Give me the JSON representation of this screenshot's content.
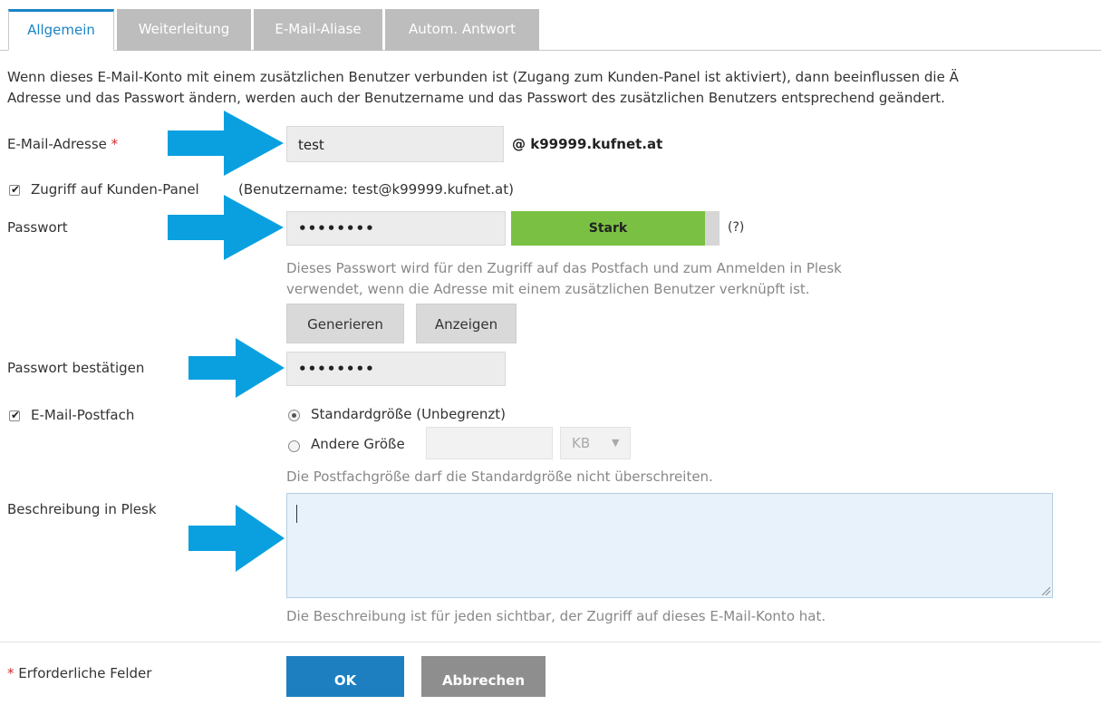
{
  "tabs": [
    {
      "label": "Allgemein"
    },
    {
      "label": "Weiterleitung"
    },
    {
      "label": "E-Mail-Aliase"
    },
    {
      "label": "Autom. Antwort"
    }
  ],
  "info_line1": "Wenn dieses E-Mail-Konto mit einem zusätzlichen Benutzer verbunden ist (Zugang zum Kunden-Panel ist aktiviert), dann beeinflussen die Ä",
  "info_line2": "Adresse und das Passwort ändern, werden auch der Benutzername und das Passwort des zusätzlichen Benutzers entsprechend geändert.",
  "email": {
    "label": "E-Mail-Adresse",
    "required_mark": "*",
    "value": "test",
    "domain": "@ k99999.kufnet.at"
  },
  "panel_access": {
    "checked": true,
    "label": "Zugriff auf Kunden-Panel",
    "username_note": "(Benutzername: test@k99999.kufnet.at)"
  },
  "password": {
    "label": "Passwort",
    "value": "••••••••",
    "strength": "Stark",
    "strength_color": "#7ac143",
    "help": "(?)",
    "hint_line1": "Dieses Passwort wird für den Zugriff auf das Postfach und zum Anmelden in Plesk",
    "hint_line2": "verwendet, wenn die Adresse mit einem zusätzlichen Benutzer verknüpft ist.",
    "generate_label": "Generieren",
    "show_label": "Anzeigen"
  },
  "confirm": {
    "label": "Passwort bestätigen",
    "value": "••••••••"
  },
  "mailbox": {
    "checked": true,
    "label": "E-Mail-Postfach",
    "option_default": "Standardgröße (Unbegrenzt)",
    "option_other": "Andere Größe",
    "unit": "KB",
    "hint": "Die Postfachgröße darf die Standardgröße nicht überschreiten."
  },
  "description": {
    "label": "Beschreibung in Plesk",
    "value": "",
    "hint": "Die Beschreibung ist für jeden sichtbar, der Zugriff auf dieses E-Mail-Konto hat."
  },
  "footer": {
    "required_mark": "*",
    "required_note": "Erforderliche Felder",
    "ok_label": "OK",
    "cancel_label": "Abbrechen"
  },
  "colors": {
    "accent": "#1d7fc0",
    "arrow": "#0aa0e0",
    "required": "#d02c2c"
  }
}
